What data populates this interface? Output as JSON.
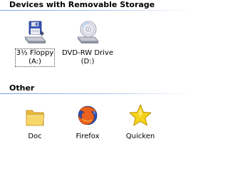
{
  "sections": [
    {
      "title": "Devices with Removable Storage",
      "items": [
        {
          "label_line1": "3½ Floppy",
          "label_line2": "(A:)",
          "icon": "floppy-drive-icon",
          "selected": true
        },
        {
          "label_line1": "DVD-RW Drive",
          "label_line2": "(D:)",
          "icon": "dvd-drive-icon",
          "selected": false
        }
      ]
    },
    {
      "title": "Other",
      "items": [
        {
          "label_line1": "Doc",
          "icon": "folder-icon"
        },
        {
          "label_line1": "Firefox",
          "icon": "firefox-icon"
        },
        {
          "label_line1": "Quicken",
          "icon": "quicken-star-icon"
        }
      ]
    }
  ],
  "colors": {
    "header_rule": "#7ba2e7",
    "folder": "#f5d35a",
    "star": "#f7d21a"
  }
}
